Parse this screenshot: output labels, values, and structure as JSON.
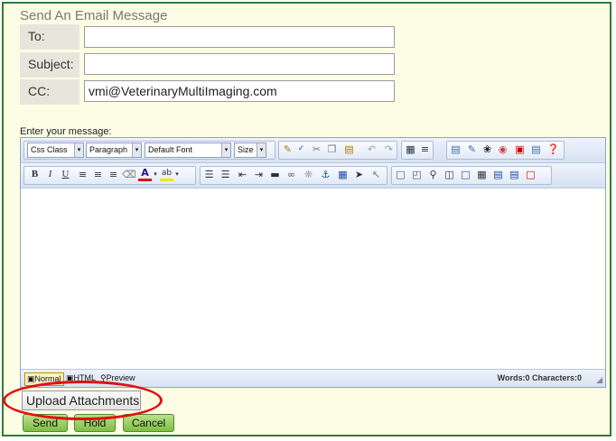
{
  "title": "Send An Email Message",
  "fields": {
    "to_label": "To:",
    "to_value": "",
    "subject_label": "Subject:",
    "subject_value": "",
    "cc_label": "CC:",
    "cc_value": "vmi@VeterinaryMultiImaging.com"
  },
  "message_label": "Enter your message:",
  "toolbar": {
    "css_class": "Css Class",
    "paragraph": "Paragraph",
    "font": "Default Font",
    "size": "Size",
    "bold": "B",
    "italic": "I",
    "underline": "U"
  },
  "modes": {
    "normal": "Normal",
    "html": "HTML",
    "preview": "Preview"
  },
  "counter": "Words:0 Characters:0",
  "buttons": {
    "upload": "Upload Attachments",
    "send": "Send",
    "hold": "Hold",
    "cancel": "Cancel"
  },
  "colors": {
    "frame_border": "#2e7d32",
    "background": "#fdfde6",
    "button_green": "#7fbe45",
    "highlight_oval": "#e01010"
  }
}
